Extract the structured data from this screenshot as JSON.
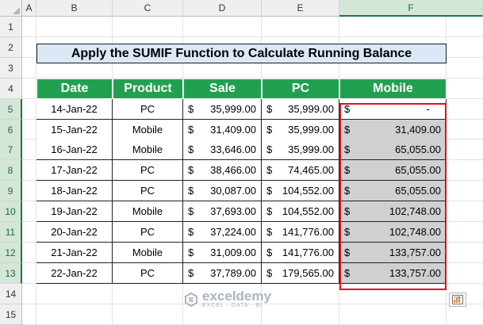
{
  "columns": [
    "A",
    "B",
    "C",
    "D",
    "E",
    "F"
  ],
  "selected_column": "F",
  "rows": [
    "1",
    "2",
    "3",
    "4",
    "5",
    "6",
    "7",
    "8",
    "9",
    "10",
    "11",
    "12",
    "13",
    "14",
    "15"
  ],
  "title": "Apply the SUMIF Function to Calculate Running Balance",
  "headers": [
    "Date",
    "Product",
    "Sale",
    "PC",
    "Mobile"
  ],
  "currency_symbol": "$",
  "data": [
    {
      "date": "14-Jan-22",
      "product": "PC",
      "sale": "35,999.00",
      "pc": "35,999.00",
      "mobile": "-"
    },
    {
      "date": "15-Jan-22",
      "product": "Mobile",
      "sale": "31,409.00",
      "pc": "35,999.00",
      "mobile": "31,409.00"
    },
    {
      "date": "16-Jan-22",
      "product": "Mobile",
      "sale": "33,646.00",
      "pc": "35,999.00",
      "mobile": "65,055.00"
    },
    {
      "date": "17-Jan-22",
      "product": "PC",
      "sale": "38,466.00",
      "pc": "74,465.00",
      "mobile": "65,055.00"
    },
    {
      "date": "18-Jan-22",
      "product": "PC",
      "sale": "30,087.00",
      "pc": "104,552.00",
      "mobile": "65,055.00"
    },
    {
      "date": "19-Jan-22",
      "product": "Mobile",
      "sale": "37,693.00",
      "pc": "104,552.00",
      "mobile": "102,748.00"
    },
    {
      "date": "20-Jan-22",
      "product": "PC",
      "sale": "37,224.00",
      "pc": "141,776.00",
      "mobile": "102,748.00"
    },
    {
      "date": "21-Jan-22",
      "product": "Mobile",
      "sale": "31,009.00",
      "pc": "141,776.00",
      "mobile": "133,757.00"
    },
    {
      "date": "22-Jan-22",
      "product": "PC",
      "sale": "37,789.00",
      "pc": "179,565.00",
      "mobile": "133,757.00"
    }
  ],
  "watermark": {
    "name": "exceldemy",
    "tagline": "EXCEL · DATA · BI"
  },
  "colors": {
    "header_green": "#21a150",
    "title_fill": "#dbe9f7",
    "highlight_gray": "#d0d0d0",
    "selection_red": "#e0101e"
  }
}
